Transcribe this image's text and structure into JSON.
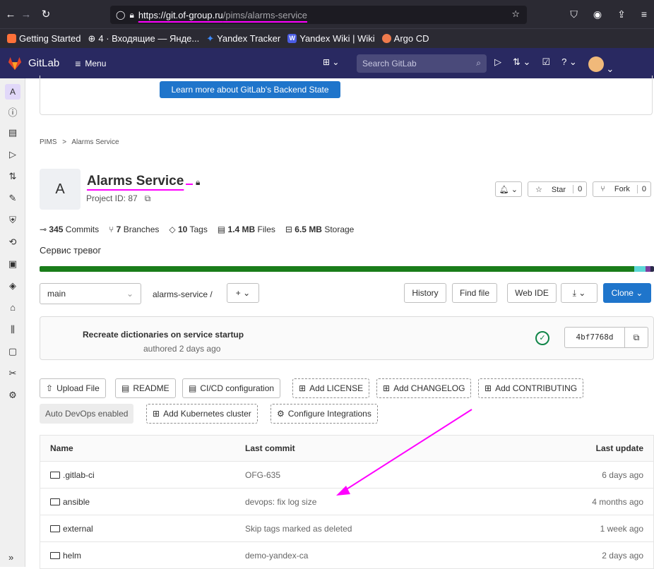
{
  "browser": {
    "url_host": "https://git.of-group.ru",
    "url_path": "/pims/alarms-service"
  },
  "bookmarks": [
    {
      "label": "Getting Started"
    },
    {
      "label": "4 · Входящие — Янде..."
    },
    {
      "label": "Yandex Tracker"
    },
    {
      "label": "Yandex Wiki | Wiki"
    },
    {
      "label": "Argo CD"
    }
  ],
  "header": {
    "app_name": "GitLab",
    "menu_label": "Menu",
    "search_placeholder": "Search GitLab"
  },
  "sidebar": {
    "project_letter": "A"
  },
  "banner": {
    "button_label": "Learn more about GitLab's Backend State"
  },
  "breadcrumb": {
    "group": "PIMS",
    "separator": ">",
    "project": "Alarms Service"
  },
  "project": {
    "avatar_letter": "A",
    "title": "Alarms Service",
    "id_label": "Project ID: 87",
    "description": "Сервис тревог",
    "star_label": "Star",
    "star_count": "0",
    "fork_label": "Fork",
    "fork_count": "0"
  },
  "stats": {
    "commits_num": "345",
    "commits_label": "Commits",
    "branches_num": "7",
    "branches_label": "Branches",
    "tags_num": "10",
    "tags_label": "Tags",
    "files_num": "1.4 MB",
    "files_label": "Files",
    "storage_num": "6.5 MB",
    "storage_label": "Storage"
  },
  "repo": {
    "branch": "main",
    "path": "alarms-service",
    "path_sep": "/",
    "history_label": "History",
    "find_file_label": "Find file",
    "web_ide_label": "Web IDE",
    "clone_label": "Clone"
  },
  "last_commit": {
    "title": "Recreate dictionaries on service startup",
    "meta": "authored 2 days ago",
    "sha": "4bf7768d"
  },
  "quick_actions": {
    "upload": "Upload File",
    "readme": "README",
    "cicd": "CI/CD configuration",
    "license": "Add LICENSE",
    "changelog": "Add CHANGELOG",
    "contributing": "Add CONTRIBUTING",
    "autodevops": "Auto DevOps enabled",
    "kubernetes": "Add Kubernetes cluster",
    "integrations": "Configure Integrations"
  },
  "file_tree": {
    "headers": {
      "name": "Name",
      "commit": "Last commit",
      "date": "Last update"
    },
    "rows": [
      {
        "name": ".gitlab-ci",
        "commit": "OFG-635",
        "date": "6 days ago"
      },
      {
        "name": "ansible",
        "commit": "devops: fix log size",
        "date": "4 months ago"
      },
      {
        "name": "external",
        "commit": "Skip tags marked as deleted",
        "date": "1 week ago"
      },
      {
        "name": "helm",
        "commit": "demo-yandex-ca",
        "date": "2 days ago"
      }
    ]
  },
  "colors": {
    "header_bg": "#292961",
    "accent_blue": "#1f75cb",
    "success_green": "#108548",
    "annotation_magenta": "#ff00ff"
  }
}
